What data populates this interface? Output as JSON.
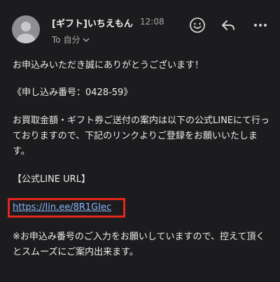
{
  "header": {
    "sender_name": "[ギフト]いちえもん",
    "time": "12:08",
    "recipient": "To 自分"
  },
  "icons": {
    "avatar": "person-avatar-icon",
    "emoji": "smiley-emoji-icon",
    "reply": "reply-arrow-icon",
    "more": "more-horizontal-icon",
    "chevron": "chevron-down-icon"
  },
  "message": {
    "greeting": "お申込みいただき誠にありがとうございます！",
    "application_number": "《申し込み番号：0428-59》",
    "instructions": "お買取金額・ギフト券ご送付の案内は以下の公式LINEにて行っておりますので、下記のリンクよりご登録をお願いいたします。",
    "line_url_label": "【公式LINE URL】",
    "line_url": "https://lin.ee/8R1GIec",
    "note": "※お申込み番号のご入力をお願いしていますので、控えて頂くとスムーズにご案内出来ます。"
  },
  "colors": {
    "background": "#1c1c1e",
    "link": "#8ab4f8",
    "highlight_box": "#e3261c"
  }
}
